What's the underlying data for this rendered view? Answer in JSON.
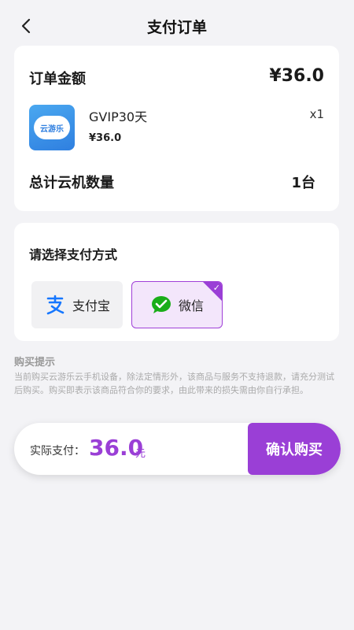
{
  "header": {
    "title": "支付订单",
    "back_icon": "chevron-left-icon"
  },
  "order": {
    "label": "订单金额",
    "amount": "¥36.0",
    "product": {
      "icon_text": "云游乐",
      "name": "GVIP30天",
      "price": "¥36.0",
      "quantity": "x1"
    },
    "total_label": "总计云机数量",
    "total_value": "1台"
  },
  "payment": {
    "title": "请选择支付方式",
    "options": [
      {
        "label": "支付宝",
        "icon": "alipay-icon",
        "selected": false
      },
      {
        "label": "微信",
        "icon": "wechat-icon",
        "selected": true
      }
    ],
    "accent_color": "#9a3fd6"
  },
  "notice": {
    "title": "购买提示",
    "text": "当前购买云游乐云手机设备，除法定情形外，该商品与服务不支持退款，请充分测试后购买。购买即表示该商品符合你的要求，由此带来的损失需由你自行承担。"
  },
  "footer": {
    "actual_label": "实际支付：",
    "amount": "36.0",
    "unit": "元",
    "confirm_label": "确认购买"
  }
}
